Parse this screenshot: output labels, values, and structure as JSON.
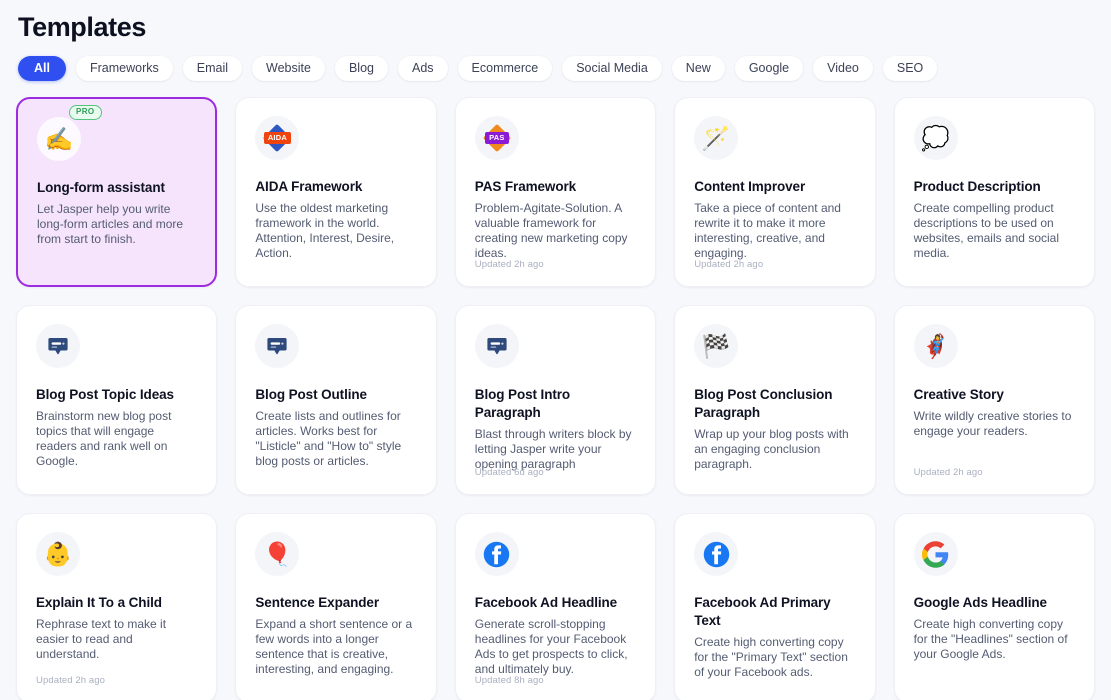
{
  "header": {
    "title": "Templates"
  },
  "filters": [
    {
      "label": "All",
      "active": true
    },
    {
      "label": "Frameworks",
      "active": false
    },
    {
      "label": "Email",
      "active": false
    },
    {
      "label": "Website",
      "active": false
    },
    {
      "label": "Blog",
      "active": false
    },
    {
      "label": "Ads",
      "active": false
    },
    {
      "label": "Ecommerce",
      "active": false
    },
    {
      "label": "Social Media",
      "active": false
    },
    {
      "label": "New",
      "active": false
    },
    {
      "label": "Google",
      "active": false
    },
    {
      "label": "Video",
      "active": false
    },
    {
      "label": "SEO",
      "active": false
    }
  ],
  "colors": {
    "page_background": "#f7f8fc",
    "accent_blue": "#2f4ff0",
    "featured_border": "#9b2ce0",
    "featured_background": "#f5e4fb",
    "pro_badge_text": "#2f9d5b",
    "pro_badge_background": "#e9fbef",
    "card_background": "#ffffff",
    "title_text": "#0e1222",
    "body_text": "#545c72",
    "updated_text": "#aab0c0"
  },
  "cards": [
    {
      "title": "Long-form assistant",
      "description": "Let Jasper help you write long-form articles and more from start to finish.",
      "icon": "writing-hand-icon",
      "icon_glyph": "✍️",
      "badge": "PRO",
      "featured": true,
      "updated": ""
    },
    {
      "title": "AIDA Framework",
      "description": "Use the oldest marketing framework in the world. Attention, Interest, Desire, Action.",
      "icon": "aida-badge-icon",
      "icon_glyph": "AIDA",
      "badge": "",
      "featured": false,
      "updated": ""
    },
    {
      "title": "PAS Framework",
      "description": "Problem-Agitate-Solution. A valuable framework for creating new marketing copy ideas.",
      "icon": "pas-badge-icon",
      "icon_glyph": "PAS",
      "badge": "",
      "featured": false,
      "updated": "Updated 2h ago"
    },
    {
      "title": "Content Improver",
      "description": "Take a piece of content and rewrite it to make it more interesting, creative, and engaging.",
      "icon": "magic-wand-icon",
      "icon_glyph": "🪄",
      "badge": "",
      "featured": false,
      "updated": "Updated 2h ago"
    },
    {
      "title": "Product Description",
      "description": "Create compelling product descriptions to be used on websites, emails and social media.",
      "icon": "thought-balloon-icon",
      "icon_glyph": "💭",
      "badge": "",
      "featured": false,
      "updated": ""
    },
    {
      "title": "Blog Post Topic Ideas",
      "description": "Brainstorm new blog post topics that will engage readers and rank well on Google.",
      "icon": "speech-balloon-icon",
      "icon_glyph": "💬",
      "badge": "",
      "featured": false,
      "updated": ""
    },
    {
      "title": "Blog Post Outline",
      "description": "Create lists and outlines for articles. Works best for \"Listicle\" and \"How to\" style blog posts or articles.",
      "icon": "speech-balloon-icon",
      "icon_glyph": "💬",
      "badge": "",
      "featured": false,
      "updated": ""
    },
    {
      "title": "Blog Post Intro Paragraph",
      "description": "Blast through writers block by letting Jasper write your opening paragraph",
      "icon": "speech-balloon-icon",
      "icon_glyph": "💬",
      "badge": "",
      "featured": false,
      "updated": "Updated 6d ago"
    },
    {
      "title": "Blog Post Conclusion Paragraph",
      "description": "Wrap up your blog posts with an engaging conclusion paragraph.",
      "icon": "chequered-flag-icon",
      "icon_glyph": "🏁",
      "badge": "",
      "featured": false,
      "updated": ""
    },
    {
      "title": "Creative Story",
      "description": "Write wildly creative stories to engage your readers.",
      "icon": "superhero-icon",
      "icon_glyph": "🦸‍♀️",
      "badge": "",
      "featured": false,
      "updated": "Updated 2h ago"
    },
    {
      "title": "Explain It To a Child",
      "description": "Rephrase text to make it easier to read and understand.",
      "icon": "baby-icon",
      "icon_glyph": "👶",
      "badge": "",
      "featured": false,
      "updated": "Updated 2h ago"
    },
    {
      "title": "Sentence Expander",
      "description": "Expand a short sentence or a few words into a longer sentence that is creative, interesting, and engaging.",
      "icon": "balloon-icon",
      "icon_glyph": "🎈",
      "badge": "",
      "featured": false,
      "updated": ""
    },
    {
      "title": "Facebook Ad Headline",
      "description": "Generate scroll-stopping headlines for your Facebook Ads to get prospects to click, and ultimately buy.",
      "icon": "facebook-icon",
      "icon_glyph": "",
      "badge": "",
      "featured": false,
      "updated": "Updated 8h ago"
    },
    {
      "title": "Facebook Ad Primary Text",
      "description": "Create high converting copy for the \"Primary Text\" section of your Facebook ads.",
      "icon": "facebook-icon",
      "icon_glyph": "",
      "badge": "",
      "featured": false,
      "updated": ""
    },
    {
      "title": "Google Ads Headline",
      "description": "Create high converting copy for the \"Headlines\" section of your Google Ads.",
      "icon": "google-icon",
      "icon_glyph": "",
      "badge": "",
      "featured": false,
      "updated": ""
    }
  ]
}
